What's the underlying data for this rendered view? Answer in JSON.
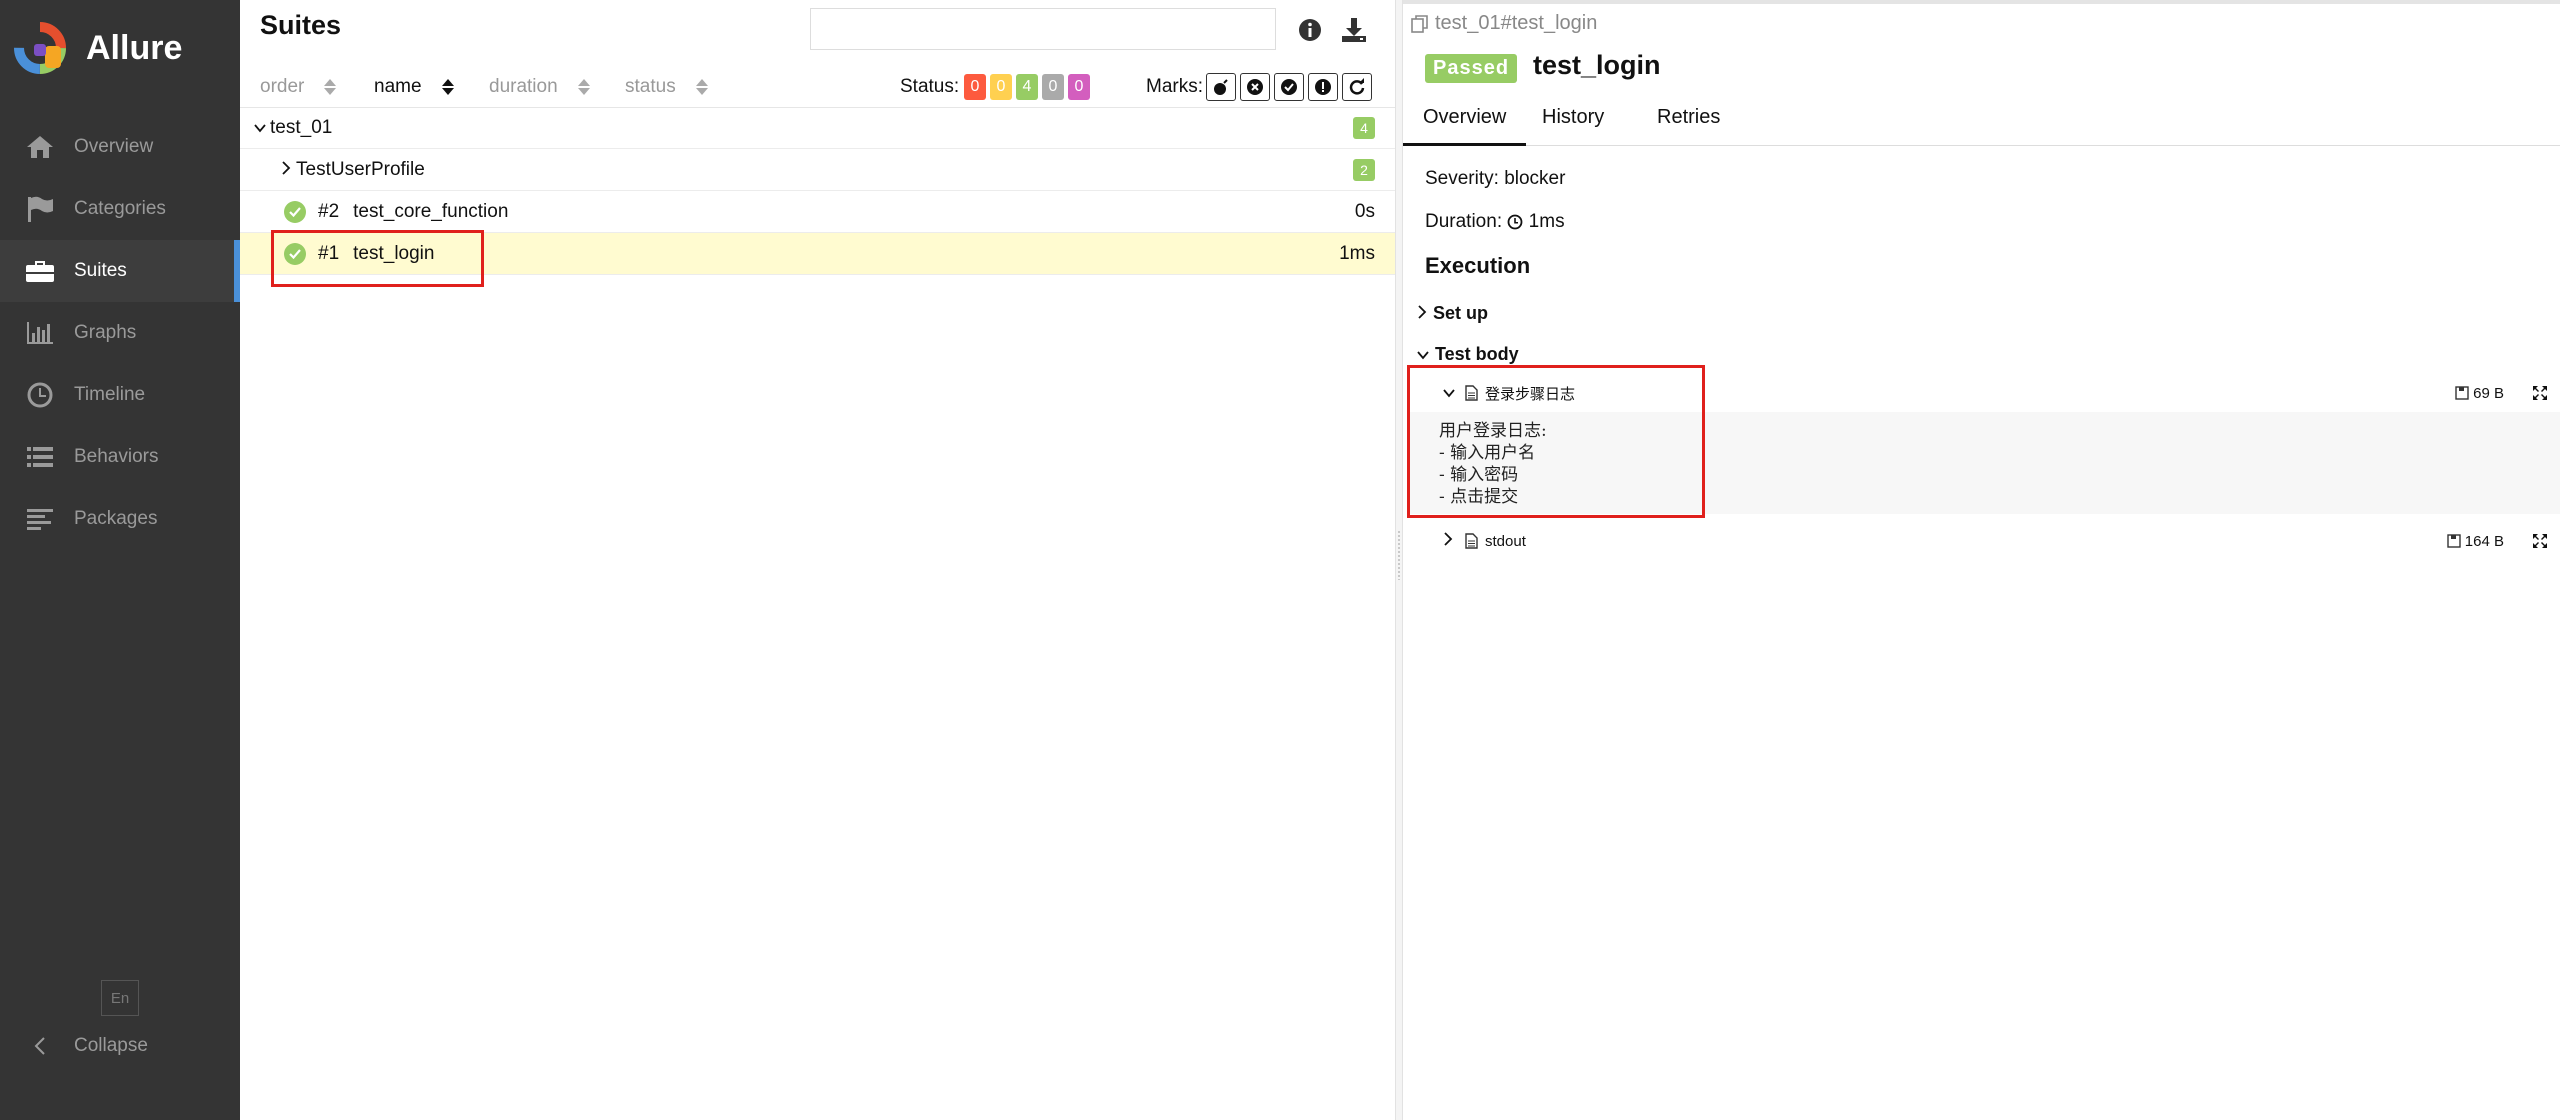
{
  "app": {
    "name": "Allure"
  },
  "sidebar": {
    "items": [
      {
        "label": "Overview",
        "icon": "home-icon",
        "active": false
      },
      {
        "label": "Categories",
        "icon": "flag-icon",
        "active": false
      },
      {
        "label": "Suites",
        "icon": "briefcase-icon",
        "active": true
      },
      {
        "label": "Graphs",
        "icon": "bar-chart-icon",
        "active": false
      },
      {
        "label": "Timeline",
        "icon": "clock-icon",
        "active": false
      },
      {
        "label": "Behaviors",
        "icon": "list-icon",
        "active": false
      },
      {
        "label": "Packages",
        "icon": "align-left-icon",
        "active": false
      }
    ],
    "language": "En",
    "collapse_label": "Collapse"
  },
  "suites": {
    "title": "Suites",
    "search": {
      "value": "",
      "placeholder": ""
    },
    "sort_columns": [
      "order",
      "name",
      "duration",
      "status"
    ],
    "active_sort": "name",
    "status_label": "Status:",
    "status_counts": [
      {
        "value": "0",
        "color": "#fd5a3e"
      },
      {
        "value": "0",
        "color": "#ffd050"
      },
      {
        "value": "4",
        "color": "#97cc64"
      },
      {
        "value": "0",
        "color": "#aaaaaa"
      },
      {
        "value": "0",
        "color": "#d35ebe"
      }
    ],
    "marks_label": "Marks:",
    "tree": {
      "suite": {
        "name": "test_01",
        "count": "4"
      },
      "group": {
        "name": "TestUserProfile",
        "count": "2"
      },
      "cases": [
        {
          "num": "#2",
          "name": "test_core_function",
          "duration": "0s",
          "status": "passed"
        },
        {
          "num": "#1",
          "name": "test_login",
          "duration": "1ms",
          "status": "passed",
          "selected": true
        }
      ]
    }
  },
  "detail": {
    "breadcrumb": "test_01#test_login",
    "status": "Passed",
    "title": "test_login",
    "tabs": [
      "Overview",
      "History",
      "Retries"
    ],
    "severity_label": "Severity:",
    "severity": "blocker",
    "duration_label": "Duration:",
    "duration": "1ms",
    "execution_title": "Execution",
    "setup_label": "Set up",
    "test_body_label": "Test body",
    "attachments": [
      {
        "name": "登录步骤日志",
        "size": "69 B",
        "content": "用户登录日志:\n- 输入用户名\n- 输入密码\n- 点击提交"
      },
      {
        "name": "stdout",
        "size": "164 B"
      }
    ]
  },
  "colors": {
    "accent": "#4a90d9",
    "passed": "#97cc64",
    "highlight": "#fffbd0",
    "annotation_red": "#e0201c"
  }
}
